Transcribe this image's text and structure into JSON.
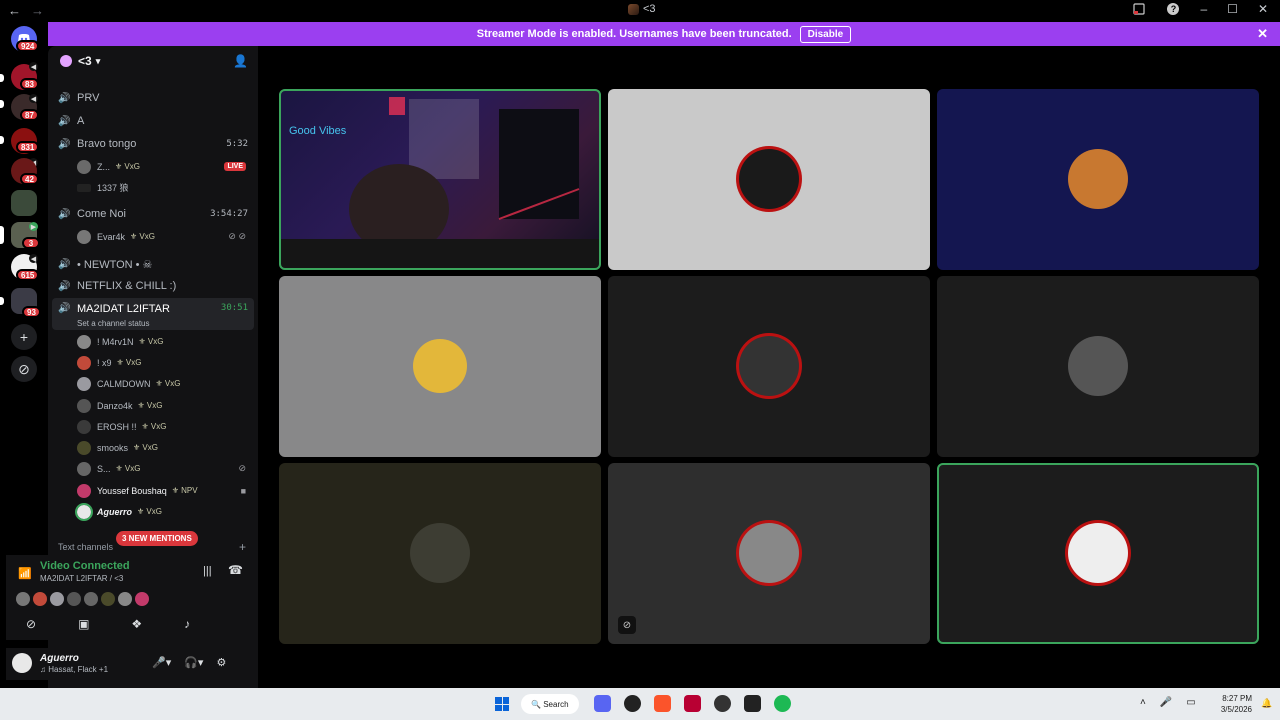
{
  "titlebar": {
    "back": "←",
    "forward": "→",
    "center_title": "<3",
    "icons": [
      "inbox-icon",
      "help-icon",
      "minimize-icon",
      "maximize-icon",
      "close-icon"
    ],
    "minimize": "–",
    "maximize": "☐",
    "close": "✕",
    "help": "?"
  },
  "banner": {
    "text": "Streamer Mode is enabled. Usernames have been truncated.",
    "button": "Disable",
    "close": "✕"
  },
  "servers": [
    {
      "badge": "924",
      "name": "discord-home"
    },
    {
      "badge": "83",
      "name": "server-1"
    },
    {
      "badge": "87",
      "name": "server-2"
    },
    {
      "badge": "831",
      "name": "server-3"
    },
    {
      "badge": "42",
      "name": "server-4"
    },
    {
      "badge": "",
      "name": "server-5"
    },
    {
      "badge": "3",
      "name": "server-6"
    },
    {
      "badge": "615",
      "name": "server-7"
    },
    {
      "badge": "93",
      "name": "server-8"
    }
  ],
  "sidebar": {
    "server_name": "<3",
    "channels": {
      "prv": "PRV",
      "a": "A",
      "bravo": {
        "label": "Bravo tongo",
        "time": "5:32",
        "live": "LIVE",
        "users": [
          {
            "name": "Z...",
            "tag": "VxG"
          },
          {
            "name": "1337 狼",
            "tag": ""
          }
        ]
      },
      "come": {
        "label": "Come Noi",
        "time": "3:54:27",
        "users": [
          {
            "name": "Evar4k",
            "tag": "VxG"
          }
        ]
      },
      "newton": "• NEWTON • ☠",
      "netflix": "NETFLIX & CHILL :)",
      "ma2idat": {
        "label": "MA2IDAT L2IFTAR",
        "time": "30:51",
        "status": "Set a channel status"
      }
    },
    "ma2idat_users": [
      {
        "name": "! M4rv1N",
        "tag": "VxG"
      },
      {
        "name": "! x9",
        "tag": "VxG"
      },
      {
        "name": "CALMDOWN",
        "tag": "VxG"
      },
      {
        "name": "Danzo4k",
        "tag": "VxG"
      },
      {
        "name": "EROSH !!",
        "tag": "VxG"
      },
      {
        "name": "smooks",
        "tag": "VxG"
      },
      {
        "name": "S...",
        "tag": "VxG"
      },
      {
        "name": "Youssef Boushaq",
        "tag": "NPV"
      },
      {
        "name": "Aguerro",
        "tag": "VxG"
      }
    ],
    "mentions": "3 NEW MENTIONS",
    "text_channels": "Text channels"
  },
  "voice_panel": {
    "title": "Video Connected",
    "subtitle": "MA2IDAT L2IFTAR / <3"
  },
  "userbar": {
    "name": "Aguerro",
    "status": "♫ Hassat, Flack +1"
  },
  "taskbar": {
    "search": "Search",
    "time": "8:27 PM",
    "date": "3/5/2026"
  },
  "colors": {
    "accent": "#9b3ff0",
    "speaking": "#3ba55c",
    "mention": "#da373c"
  }
}
